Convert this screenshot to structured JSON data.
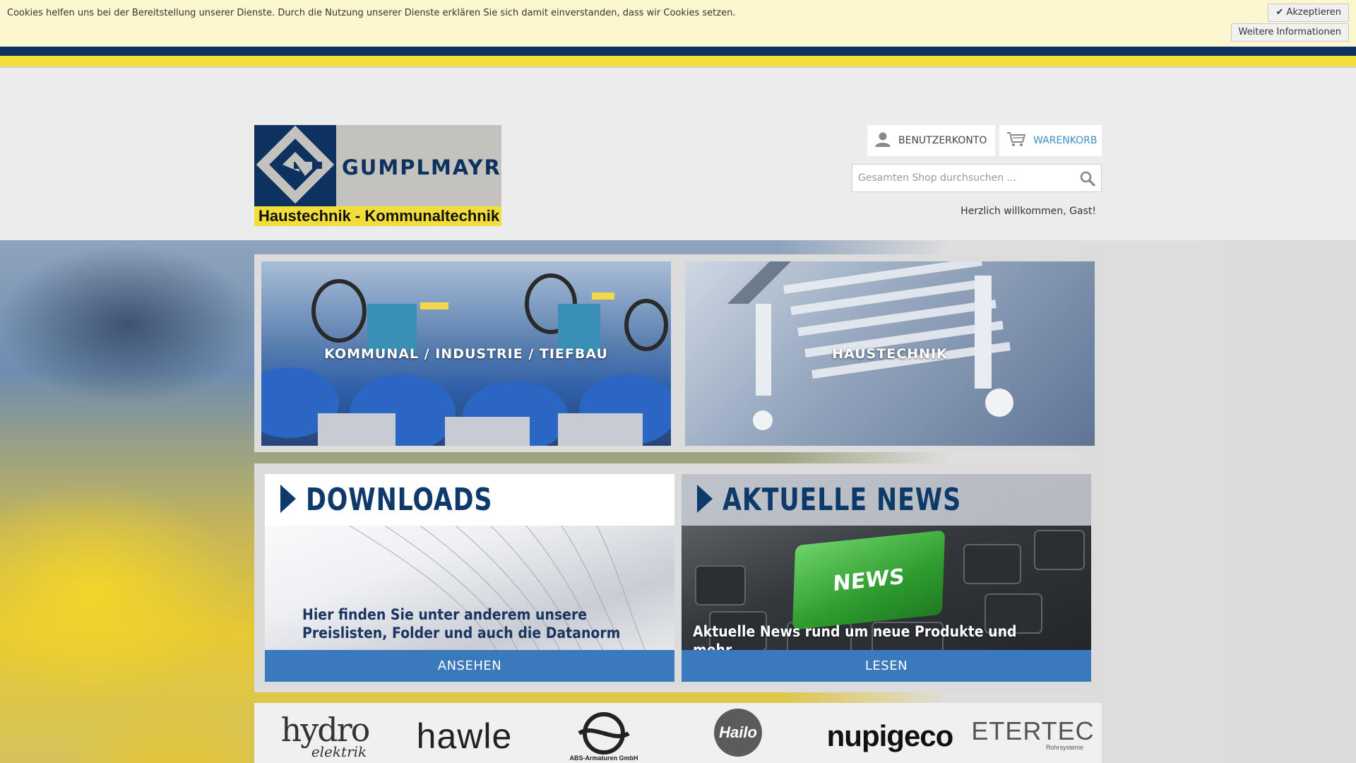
{
  "cookie_bar": {
    "text": "Cookies helfen uns bei der Bereitstellung unserer Dienste. Durch die Nutzung unserer Dienste erklären Sie sich damit einverstanden, dass wir Cookies setzen.",
    "accept_label": "✔ Akzeptieren",
    "more_label": "Weitere Informationen"
  },
  "logo": {
    "brand": "GUMPLMAYR",
    "tagline": "Haustechnik - Kommunaltechnik",
    "colors": {
      "navy": "#0e3260",
      "gray": "#c4c2bf",
      "yellow": "#f3dd3a"
    }
  },
  "header": {
    "account_label": "BENUTZERKONTO",
    "account_icon": "user-icon",
    "cart_label": "WARENKORB",
    "cart_icon": "cart-icon",
    "search_placeholder": "Gesamten Shop durchsuchen ...",
    "search_icon": "search-icon",
    "welcome": "Herzlich willkommen, Gast!"
  },
  "categories": [
    {
      "label": "KOMMUNAL / INDUSTRIE / TIEFBAU"
    },
    {
      "label": "HAUSTECHNIK"
    }
  ],
  "cards": {
    "downloads": {
      "title": "DOWNLOADS",
      "description_line1": "Hier finden Sie unter anderem unsere",
      "description_line2": "Preislisten, Folder und auch die Datanorm",
      "action": "ANSEHEN"
    },
    "news": {
      "title": "AKTUELLE NEWS",
      "key_label": "NEWS",
      "description": "Aktuelle News rund um neue Produkte und mehr...",
      "action": "LESEN"
    }
  },
  "brands": [
    {
      "name": "hydro",
      "sub": "elektrik"
    },
    {
      "name": "hawle"
    },
    {
      "name": "ABS-Armaturen GmbH"
    },
    {
      "name": "Hailo"
    },
    {
      "name": "nupigeco"
    },
    {
      "name": "ETERTEC",
      "sub": "Rohrsysteme"
    }
  ],
  "colors": {
    "accent_blue": "#3b79bd",
    "link_blue": "#3d8ec9",
    "navy": "#0e3a6b"
  }
}
